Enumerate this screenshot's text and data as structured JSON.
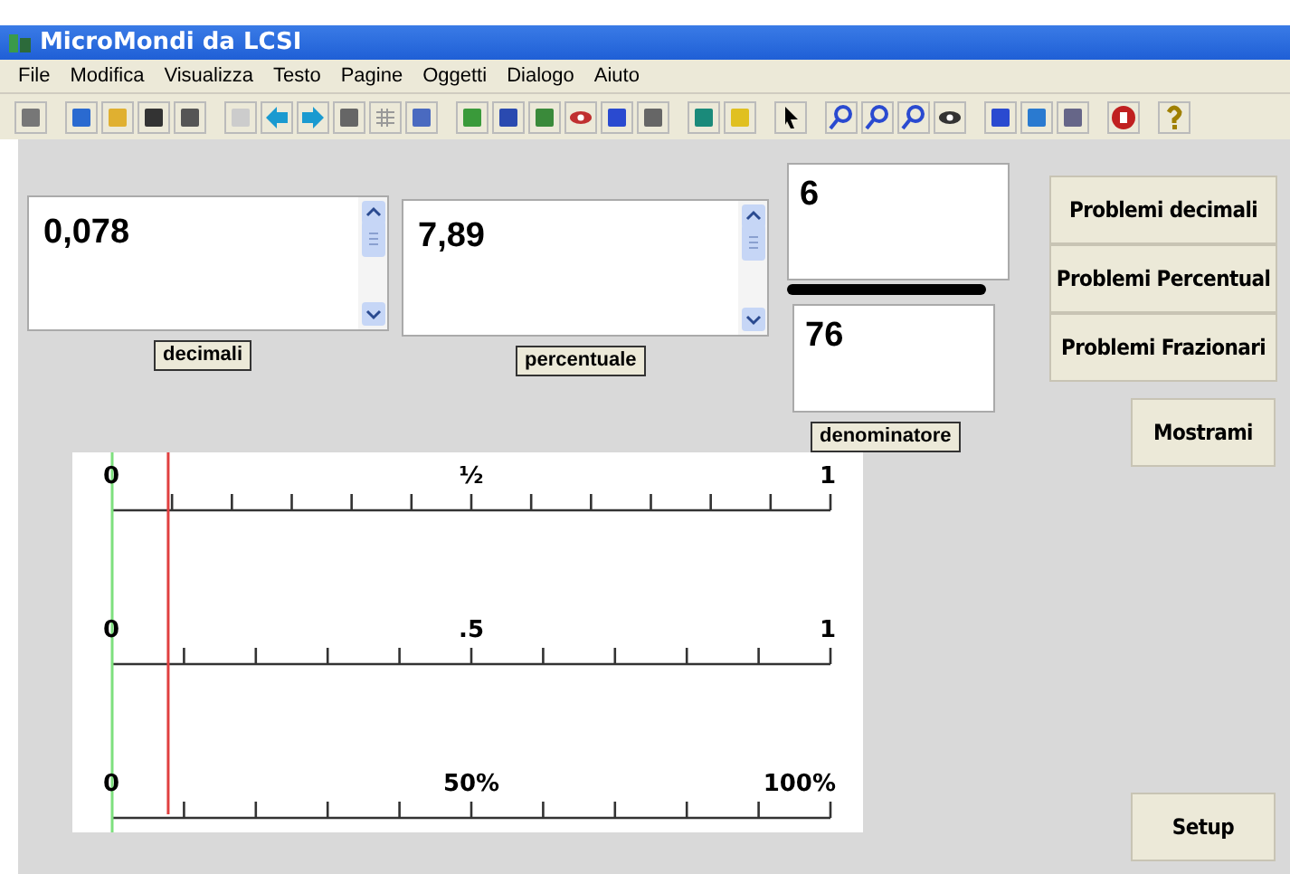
{
  "window": {
    "title": "MicroMondi da LCSI"
  },
  "menu": [
    "File",
    "Modifica",
    "Visualizza",
    "Testo",
    "Pagine",
    "Oggetti",
    "Dialogo",
    "Aiuto"
  ],
  "text_boxes": [
    {
      "value": "0,078",
      "label": "decimali"
    },
    {
      "value": "7,89",
      "label": "percentuale"
    }
  ],
  "fraction": {
    "numerator": "6",
    "denominator": "76",
    "label": "denominatore"
  },
  "buttons": [
    "Problemi decimali",
    "Problemi Percentual",
    "Problemi Frazionari"
  ],
  "show_button": "Mostrami",
  "setup_button": "Setup",
  "number_lines": [
    {
      "kind": "twelfths",
      "start": "0",
      "middle": "½",
      "end": "1"
    },
    {
      "kind": "tenths",
      "start": "0",
      "middle": ".5",
      "end": "1"
    },
    {
      "kind": "tenths",
      "start": "0",
      "middle": "50%",
      "end": "100%"
    }
  ],
  "marker": {
    "level": 0.078
  }
}
